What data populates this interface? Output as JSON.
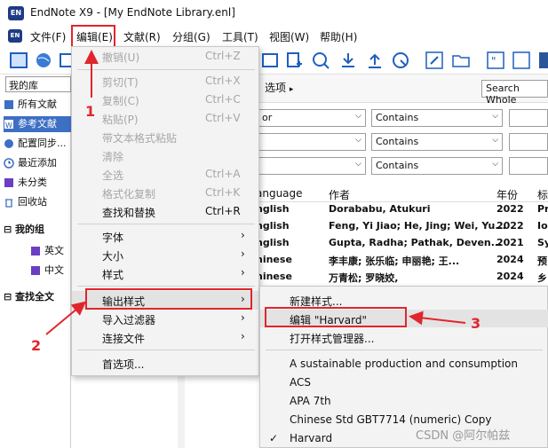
{
  "window": {
    "title": "EndNote X9 - [My EndNote Library.enl]",
    "app_badge": "EN"
  },
  "menubar": [
    "文件(F)",
    "编辑(E)",
    "文献(R)",
    "分组(G)",
    "工具(T)",
    "视图(W)",
    "帮助(H)"
  ],
  "library": {
    "selector": "我的库",
    "groups": [
      {
        "label": "所有文献",
        "icon": "library-icon"
      },
      {
        "label": "参考文献",
        "icon": "word-doc-icon",
        "selected": true
      },
      {
        "label": "配置同步...",
        "icon": "sync-icon"
      },
      {
        "label": "最近添加",
        "icon": "clock-icon"
      },
      {
        "label": "未分类",
        "icon": "unfiled-icon"
      },
      {
        "label": "回收站",
        "icon": "trash-icon"
      }
    ],
    "my_groups_header": "我的组",
    "my_groups": [
      "英文",
      "中文"
    ],
    "find_fulltext": "查找全文"
  },
  "options_tab": "选项",
  "search_box": "Search Whole",
  "search_rows": [
    {
      "field": "or",
      "op": "Contains"
    },
    {
      "field": "",
      "op": "Contains"
    },
    {
      "field": "",
      "op": "Contains"
    }
  ],
  "table": {
    "headers": [
      "anguage",
      "作者",
      "年份",
      "标"
    ],
    "rows": [
      [
        "nglish",
        "Dorababu, Atukuri",
        "2022",
        "Pr"
      ],
      [
        "nglish",
        "Feng, Yi Jiao; He, Jing; Wei, Yu...",
        "2022",
        "Io"
      ],
      [
        "nglish",
        "Gupta, Radha; Pathak, Deven...",
        "2021",
        "Sy"
      ],
      [
        "hinese",
        "李丰康; 张乐临; 申丽艳; 王...",
        "2024",
        "预"
      ],
      [
        "hinese",
        "万青松; 罗晓姣,",
        "2024",
        "乡"
      ]
    ]
  },
  "edit_menu": [
    {
      "label": "撤销(U)",
      "accel": "Ctrl+Z",
      "disabled": true
    },
    {
      "label": "剪切(T)",
      "accel": "Ctrl+X",
      "disabled": true
    },
    {
      "label": "复制(C)",
      "accel": "Ctrl+C",
      "disabled": true
    },
    {
      "label": "粘贴(P)",
      "accel": "Ctrl+V",
      "disabled": true
    },
    {
      "label": "带文本格式粘贴",
      "accel": "",
      "disabled": true
    },
    {
      "label": "清除",
      "accel": "",
      "disabled": true
    },
    {
      "label": "全选",
      "accel": "Ctrl+A",
      "disabled": true
    },
    {
      "label": "格式化复制",
      "accel": "Ctrl+K",
      "disabled": true
    },
    {
      "label": "查找和替换",
      "accel": "Ctrl+R",
      "disabled": false
    },
    {
      "label": "字体",
      "submenu": true
    },
    {
      "label": "大小",
      "submenu": true
    },
    {
      "label": "样式",
      "submenu": true
    },
    {
      "label": "输出样式",
      "submenu": true,
      "highlighted": true
    },
    {
      "label": "导入过滤器",
      "submenu": true
    },
    {
      "label": "连接文件",
      "submenu": true
    },
    {
      "label": "首选项...",
      "accel": ""
    }
  ],
  "style_submenu": {
    "actions": [
      "新建样式...",
      "编辑 \"Harvard\"",
      "打开样式管理器..."
    ],
    "styles": [
      "A  sustainable production and consumption",
      "ACS",
      "APA 7th",
      "Chinese Std GBT7714 (numeric) Copy",
      "Harvard"
    ],
    "checked": "Harvard",
    "check_mark": "✓"
  },
  "annotations": [
    "1",
    "2",
    "3"
  ],
  "watermark": "CSDN @阿尔帕兹",
  "colors": {
    "accent_red": "#e0262c",
    "selection_blue": "#3d6fc4",
    "app_icon_blue": "#1f3b86"
  }
}
